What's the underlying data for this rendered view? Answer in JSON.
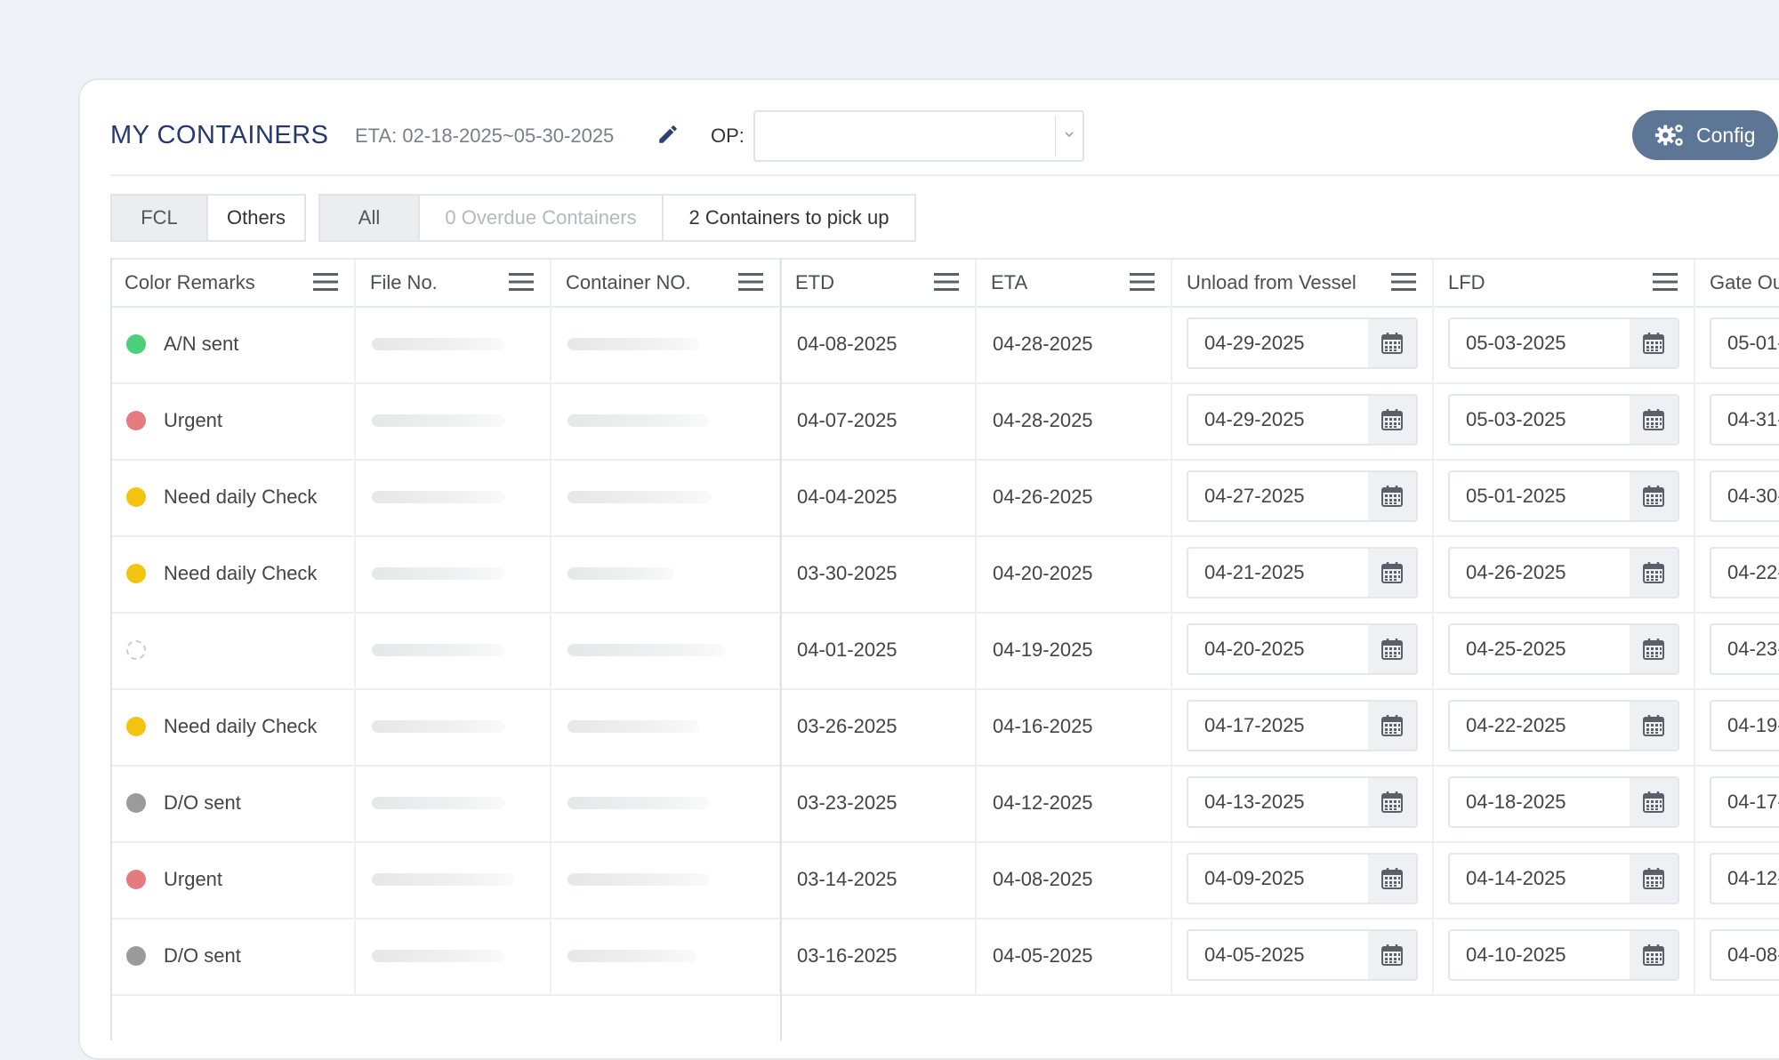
{
  "header": {
    "title": "MY CONTAINERS",
    "eta_range": "ETA: 02-18-2025~05-30-2025",
    "op_label": "OP:",
    "op_value": "",
    "config_label": "Config"
  },
  "tabs_type": [
    {
      "label": "FCL",
      "active": true
    },
    {
      "label": "Others",
      "active": false
    }
  ],
  "tabs_filter": [
    {
      "label": "All",
      "active": true
    },
    {
      "label": "0 Overdue Containers",
      "muted": true
    },
    {
      "label": "2 Containers to pick up"
    }
  ],
  "columns": [
    "Color Remarks",
    "File No.",
    "Container NO.",
    "ETD",
    "ETA",
    "Unload from Vessel",
    "LFD",
    "Gate Ou"
  ],
  "rows": [
    {
      "remark": "A/N sent",
      "color": "#4ccf7b",
      "etd": "04-08-2025",
      "eta": "04-28-2025",
      "unload": "04-29-2025",
      "lfd": "05-03-2025",
      "gate": "05-01-"
    },
    {
      "remark": "Urgent",
      "color": "#e57b7f",
      "etd": "04-07-2025",
      "eta": "04-28-2025",
      "unload": "04-29-2025",
      "lfd": "05-03-2025",
      "gate": "04-31-"
    },
    {
      "remark": "Need daily Check",
      "color": "#f2c40f",
      "etd": "04-04-2025",
      "eta": "04-26-2025",
      "unload": "04-27-2025",
      "lfd": "05-01-2025",
      "gate": "04-30-"
    },
    {
      "remark": "Need daily Check",
      "color": "#f2c40f",
      "etd": "03-30-2025",
      "eta": "04-20-2025",
      "unload": "04-21-2025",
      "lfd": "04-26-2025",
      "gate": "04-22-"
    },
    {
      "remark": "",
      "color": "",
      "etd": "04-01-2025",
      "eta": "04-19-2025",
      "unload": "04-20-2025",
      "lfd": "04-25-2025",
      "gate": "04-23-"
    },
    {
      "remark": "Need daily Check",
      "color": "#f2c40f",
      "etd": "03-26-2025",
      "eta": "04-16-2025",
      "unload": "04-17-2025",
      "lfd": "04-22-2025",
      "gate": "04-19-"
    },
    {
      "remark": "D/O sent",
      "color": "#9b9b9b",
      "etd": "03-23-2025",
      "eta": "04-12-2025",
      "unload": "04-13-2025",
      "lfd": "04-18-2025",
      "gate": "04-17-"
    },
    {
      "remark": "Urgent",
      "color": "#e57b7f",
      "etd": "03-14-2025",
      "eta": "04-08-2025",
      "unload": "04-09-2025",
      "lfd": "04-14-2025",
      "gate": "04-12-"
    },
    {
      "remark": "D/O sent",
      "color": "#9b9b9b",
      "etd": "03-16-2025",
      "eta": "04-05-2025",
      "unload": "04-05-2025",
      "lfd": "04-10-2025",
      "gate": "04-08-"
    }
  ]
}
